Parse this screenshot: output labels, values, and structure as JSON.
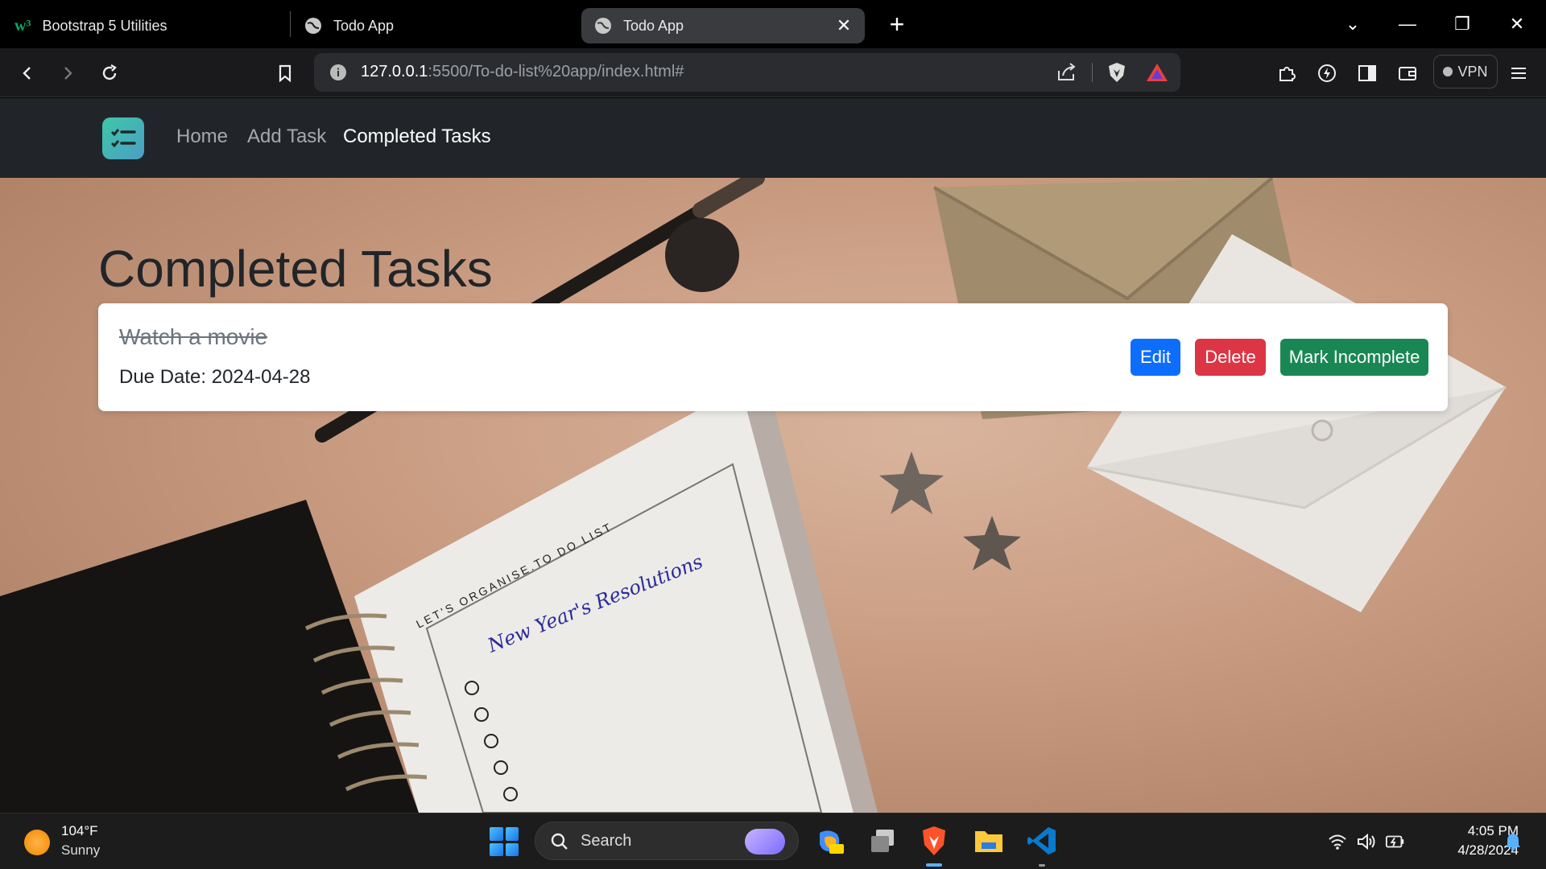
{
  "browser": {
    "tabs": [
      {
        "label": "Bootstrap 5 Utilities",
        "icon": "w3schools-icon"
      },
      {
        "label": "Todo App",
        "icon": "globe-icon"
      },
      {
        "label": "Todo App",
        "icon": "globe-icon",
        "active": true
      }
    ],
    "url": {
      "host": "127.0.0.1",
      "path": ":5500/To-do-list%20app/index.html#"
    },
    "vpn_label": "VPN"
  },
  "navbar": {
    "links": [
      "Home",
      "Add Task",
      "Completed Tasks"
    ],
    "active_link": "Completed Tasks"
  },
  "page": {
    "title": "Completed Tasks",
    "tasks": [
      {
        "title": "Watch a movie",
        "due": "Due Date: 2024-04-28",
        "completed": true,
        "buttons": {
          "edit": "Edit",
          "delete": "Delete",
          "toggle": "Mark Incomplete"
        }
      }
    ]
  },
  "taskbar": {
    "weather": {
      "temp": "104°F",
      "condition": "Sunny"
    },
    "search_label": "Search",
    "clock": {
      "time": "4:05 PM",
      "date": "4/28/2024"
    }
  },
  "colors": {
    "primary": "#0d6efd",
    "danger": "#dc3545",
    "success": "#198754",
    "navbar": "#212529"
  }
}
